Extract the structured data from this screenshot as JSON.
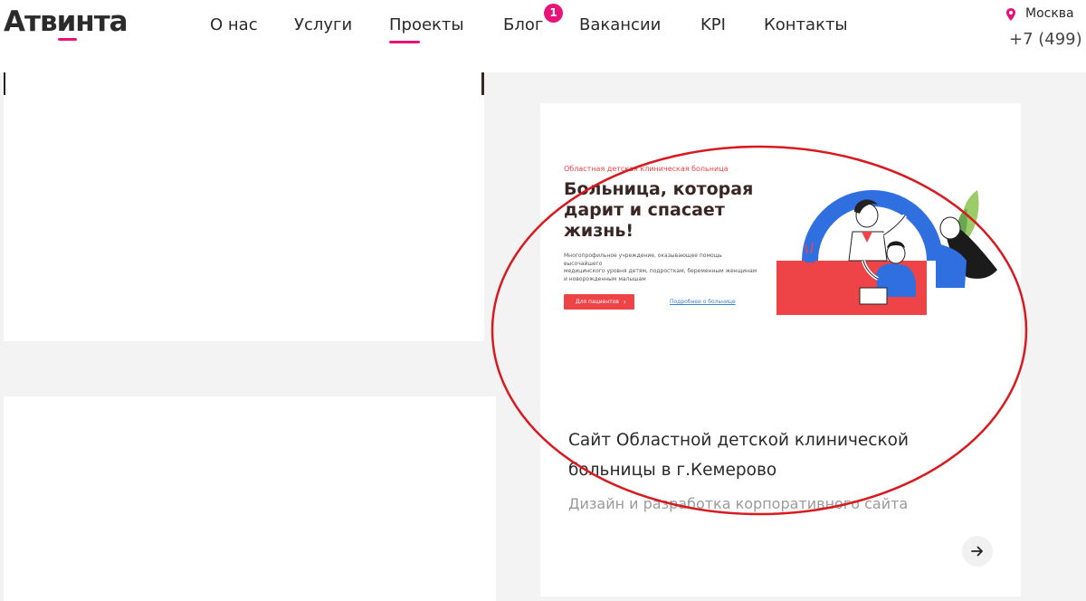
{
  "header": {
    "logo": "Атвинта",
    "nav": [
      {
        "label": "О нас"
      },
      {
        "label": "Услуги"
      },
      {
        "label": "Проекты",
        "active": true
      },
      {
        "label": "Блог",
        "badge": "1"
      },
      {
        "label": "Вакансии"
      },
      {
        "label": "KPI"
      },
      {
        "label": "Контакты"
      }
    ],
    "city": "Москва",
    "phone": "+7 (499)"
  },
  "project": {
    "preview": {
      "subtitle": "Областная детская клиническая больница",
      "title_lines": [
        "Больница, которая",
        "дарит и спасает",
        "жизнь!"
      ],
      "description_lines": [
        "Многопрофильное учреждение, оказывающее помощь высочайшего",
        "медицинского уровня детям, подросткам, беременным женщинам",
        "и новорожденным малышам"
      ],
      "primary_button": "Для пациентов",
      "secondary_link": "Подробнее о больнице"
    },
    "title_lines": [
      "Сайт Областной детской клинической",
      "больницы в г.Кемерово"
    ],
    "description": "Дизайн и разработка корпоративного сайта"
  },
  "colors": {
    "accent": "#e6147a",
    "preview_red": "#ef4447",
    "preview_blue": "#2f6fe0",
    "annotation_red": "#d71920"
  }
}
